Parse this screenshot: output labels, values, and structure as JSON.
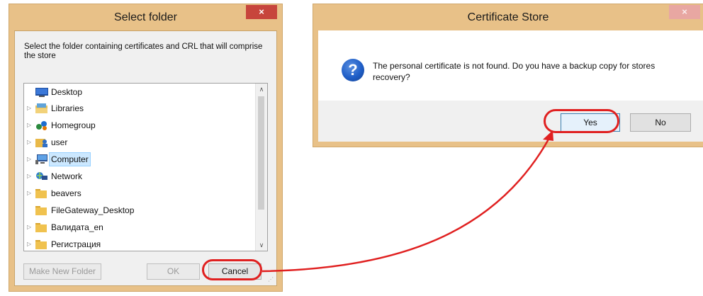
{
  "select_folder": {
    "title": "Select folder",
    "close_glyph": "×",
    "prompt": "Select the folder containing certificates and CRL that will comprise the store",
    "tree_items": [
      {
        "label": "Desktop",
        "expander": "",
        "icon": "desktop-icon"
      },
      {
        "label": "Libraries",
        "expander": "▷",
        "icon": "libraries-icon"
      },
      {
        "label": "Homegroup",
        "expander": "▷",
        "icon": "homegroup-icon"
      },
      {
        "label": "user",
        "expander": "▷",
        "icon": "user-folder-icon"
      },
      {
        "label": "Computer",
        "expander": "▷",
        "icon": "computer-icon",
        "selected": true
      },
      {
        "label": "Network",
        "expander": "▷",
        "icon": "network-icon"
      },
      {
        "label": "beavers",
        "expander": "▷",
        "icon": "folder-icon"
      },
      {
        "label": "FileGateway_Desktop",
        "expander": "",
        "icon": "folder-icon"
      },
      {
        "label": "Валидата_en",
        "expander": "▷",
        "icon": "folder-icon"
      },
      {
        "label": "Регистрация",
        "expander": "▷",
        "icon": "folder-icon"
      }
    ],
    "scroll_up": "∧",
    "scroll_down": "∨",
    "buttons": {
      "make_new_folder": "Make New Folder",
      "ok": "OK",
      "cancel": "Cancel"
    }
  },
  "certificate_store": {
    "title": "Certificate Store",
    "close_glyph": "×",
    "question_glyph": "?",
    "message": "The personal certificate is not found. Do you have a backup copy for stores recovery?",
    "buttons": {
      "yes": "Yes",
      "no": "No"
    }
  },
  "colors": {
    "frame": "#e8c188",
    "close": "#c7453c",
    "highlight": "#e02020",
    "selection": "#cce8ff"
  }
}
